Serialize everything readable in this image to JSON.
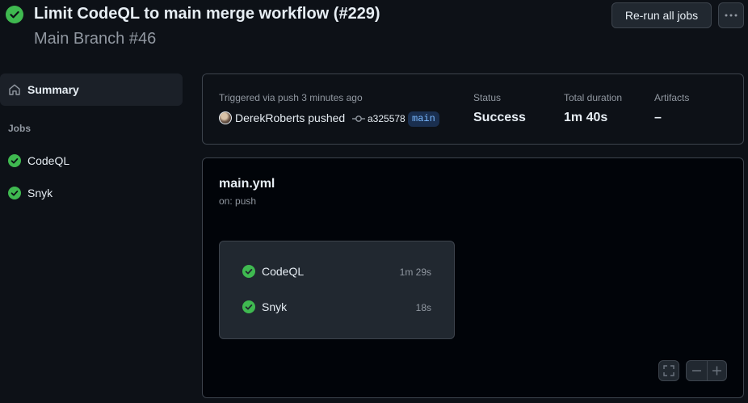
{
  "header": {
    "title": "Limit CodeQL to main merge workflow (#229)",
    "subtitle": "Main Branch #46",
    "rerun_label": "Re-run all jobs",
    "status_icon": "check-circle-icon",
    "more_icon": "kebab-horizontal-icon"
  },
  "sidebar": {
    "summary_label": "Summary",
    "summary_icon": "home-icon",
    "jobs_heading": "Jobs",
    "jobs": [
      {
        "label": "CodeQL",
        "icon": "check-circle-icon"
      },
      {
        "label": "Snyk",
        "icon": "check-circle-icon"
      }
    ]
  },
  "run_summary": {
    "triggered_text": "Triggered via push 3 minutes ago",
    "pusher": "DerekRoberts pushed",
    "commit_sha": "a325578",
    "branch": "main",
    "status_label": "Status",
    "status_value": "Success",
    "duration_label": "Total duration",
    "duration_value": "1m 40s",
    "artifacts_label": "Artifacts",
    "artifacts_value": "–"
  },
  "workflow": {
    "file": "main.yml",
    "trigger": "on: push",
    "jobs": [
      {
        "name": "CodeQL",
        "duration": "1m 29s"
      },
      {
        "name": "Snyk",
        "duration": "18s"
      }
    ]
  },
  "colors": {
    "background": "#0d1117",
    "success": "#3fb950",
    "border": "#3d444d",
    "muted_text": "#9198a1",
    "branch_text": "#79b8ff"
  }
}
